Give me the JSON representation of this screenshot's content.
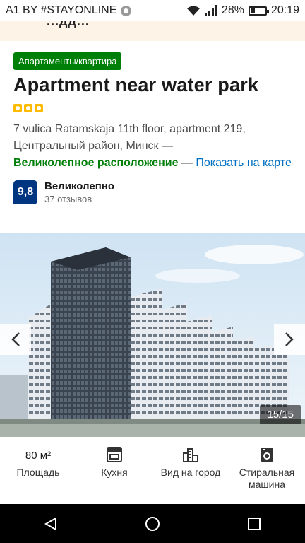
{
  "status_bar": {
    "carrier": "A1 BY #STAYONLINE",
    "battery": "28%",
    "time": "20:19"
  },
  "top_banner": {
    "cut_text": "...дд..."
  },
  "property": {
    "type_badge": "Апартаменты/квартира",
    "title": "Apartment near water park",
    "stars": 3,
    "address": "7 vulica Ratamskaja 11th floor, apartment 219, Центральный район, Минск —",
    "location_rating": "Великолепное расположение",
    "location_dash": " — ",
    "map_link": "Показать на карте",
    "score": "9,8",
    "score_word": "Великолепно",
    "reviews": "37 отзывов"
  },
  "gallery": {
    "counter": "15/15"
  },
  "amenities": {
    "area": {
      "value": "80 м²",
      "label": "Площадь"
    },
    "kitchen": {
      "label": "Кухня"
    },
    "city_view": {
      "label": "Вид на город"
    },
    "washer": {
      "label": "Стиральная машина"
    }
  },
  "colors": {
    "badge_green": "#008009",
    "link_blue": "#0071c2",
    "score_navy": "#003580",
    "star_yellow": "#febb02"
  }
}
